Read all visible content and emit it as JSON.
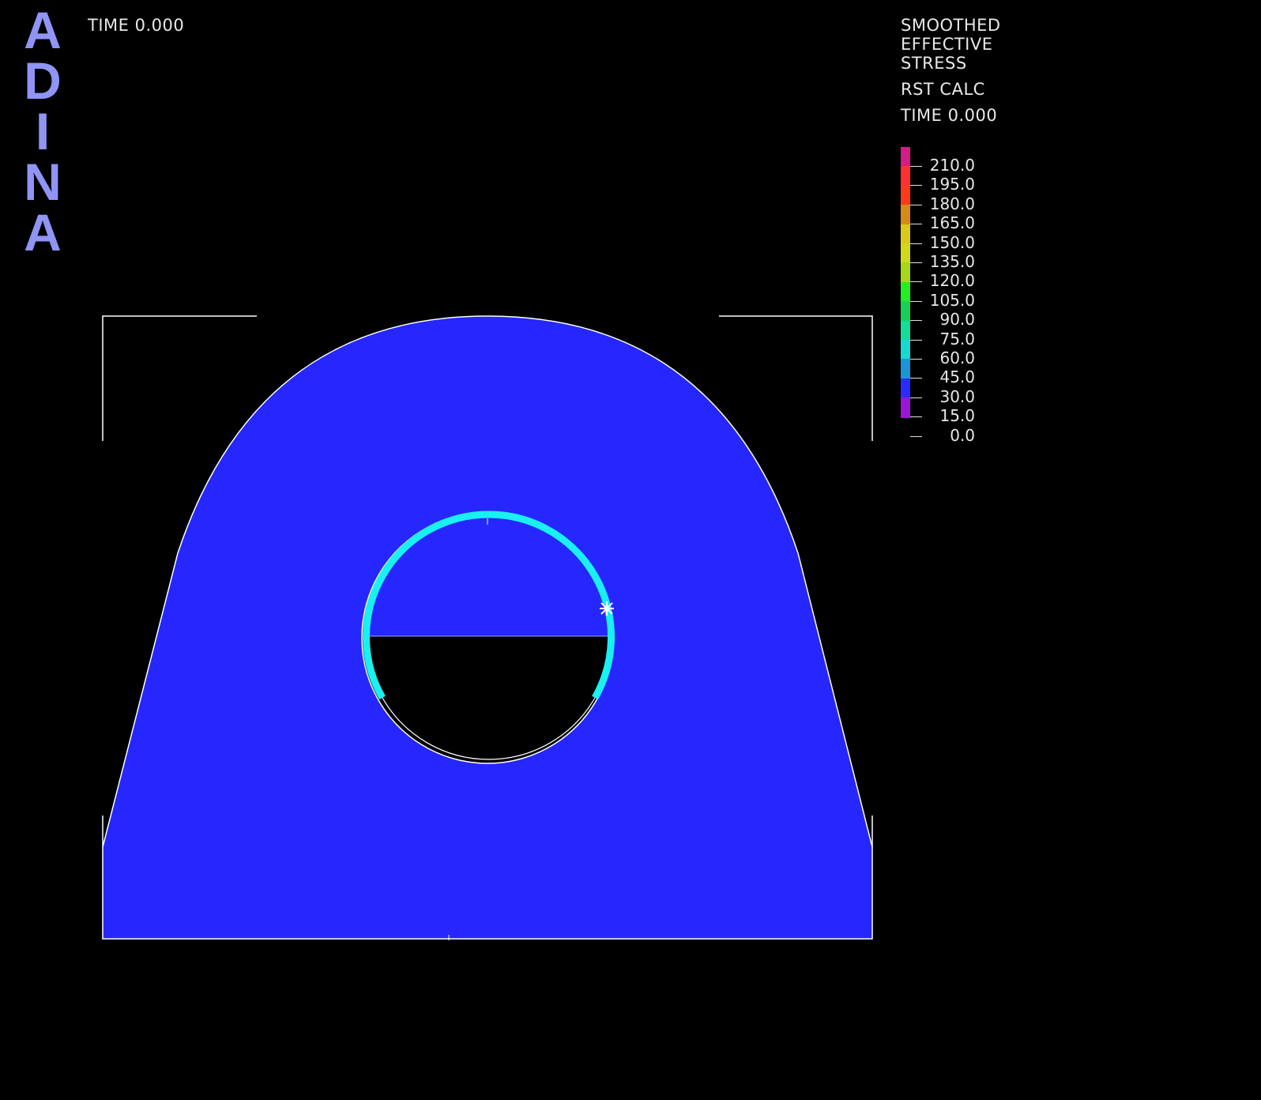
{
  "logo": {
    "letters": [
      "A",
      "D",
      "I",
      "N",
      "A"
    ],
    "color": "#8f94f5"
  },
  "time_label": "TIME 0.000",
  "legend": {
    "title_lines": [
      "SMOOTHED",
      "EFFECTIVE",
      "STRESS"
    ],
    "calc": "RST CALC",
    "time": "TIME 0.000",
    "bands": [
      {
        "color": "#d41b86"
      },
      {
        "color": "#ff3030"
      },
      {
        "color": "#ff3a1a"
      },
      {
        "color": "#d68a18"
      },
      {
        "color": "#dcc81a"
      },
      {
        "color": "#d2d81a"
      },
      {
        "color": "#a6d818"
      },
      {
        "color": "#22f022"
      },
      {
        "color": "#16d05a"
      },
      {
        "color": "#14dc9a"
      },
      {
        "color": "#18d8d4"
      },
      {
        "color": "#1a96d8"
      },
      {
        "color": "#2a2cff"
      },
      {
        "color": "#9a16d4"
      }
    ],
    "labels": [
      "210.0",
      "195.0",
      "180.0",
      "165.0",
      "150.0",
      "135.0",
      "120.0",
      "105.0",
      "90.0",
      "75.0",
      "60.0",
      "45.0",
      "30.0",
      "15.0",
      "0.0"
    ]
  },
  "model": {
    "body_color": "#2626ff",
    "hole_ring_color": "#19f0f0",
    "outline_color": "#ffffff",
    "max_marker_icon": "max-stress-marker-icon"
  }
}
